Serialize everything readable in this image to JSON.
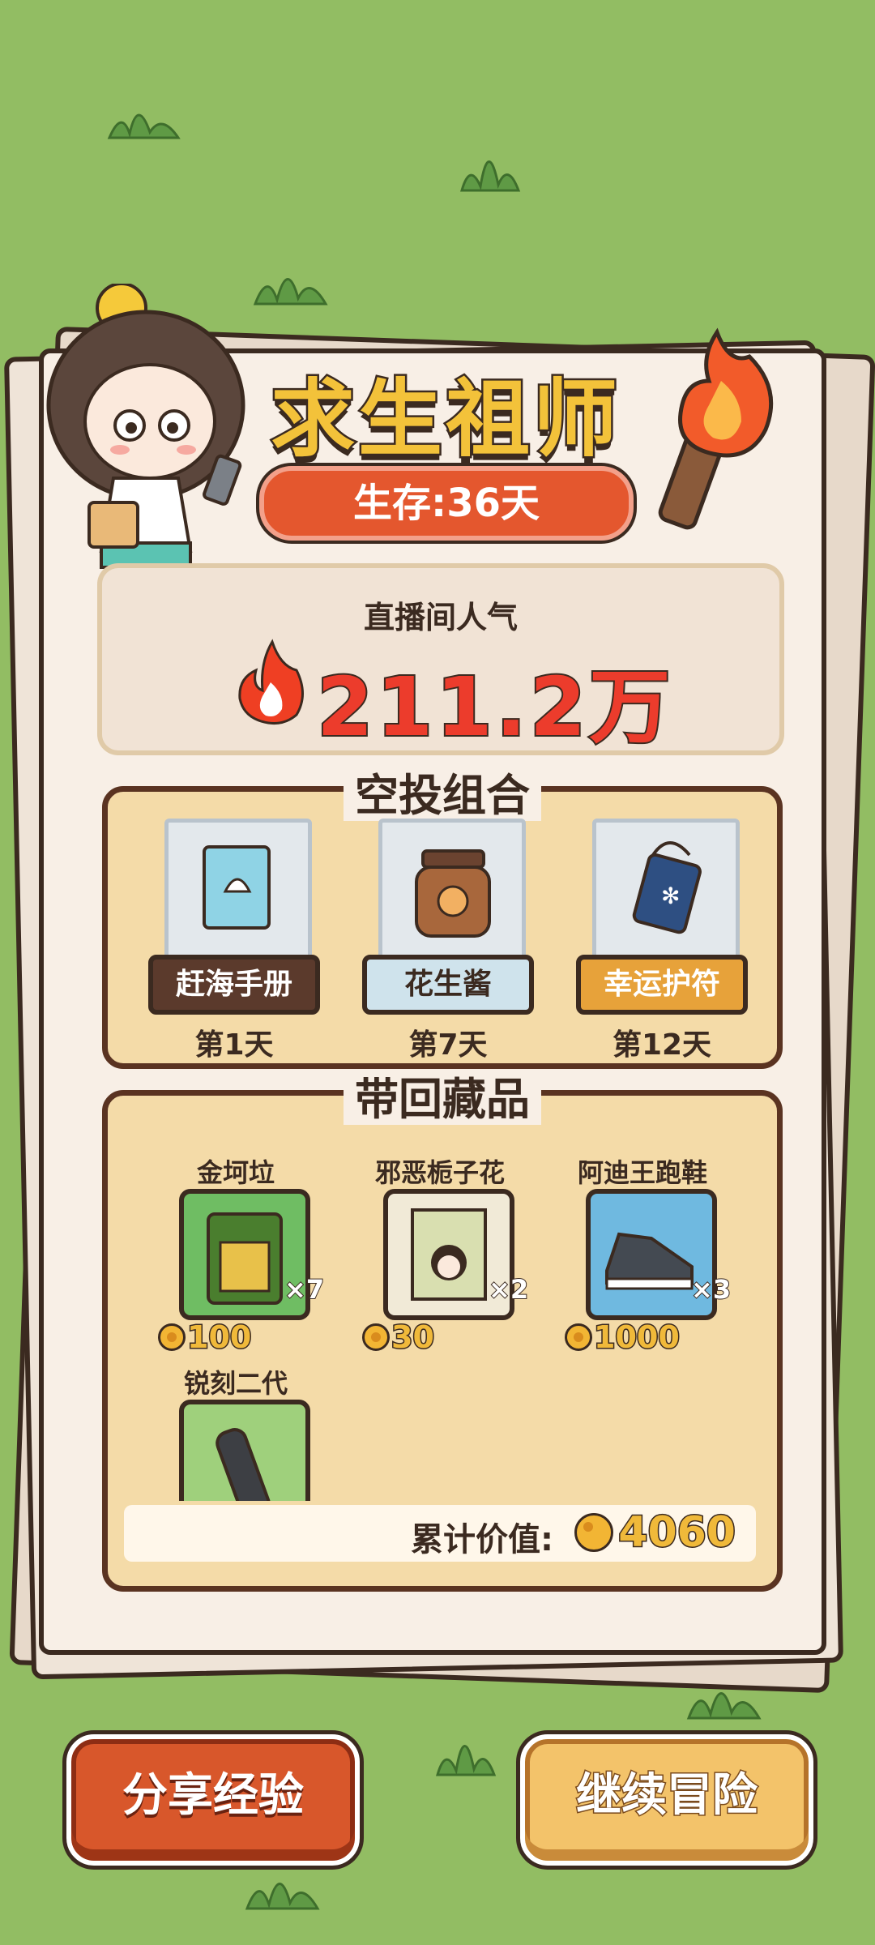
{
  "header": {
    "title": "求生祖师",
    "survival_days": "生存:36天"
  },
  "popularity": {
    "label": "直播间人气",
    "value": "211.2万"
  },
  "airdrop": {
    "title": "空投组合",
    "items": [
      {
        "name": "赶海手册",
        "day": "第1天",
        "style": "dark"
      },
      {
        "name": "花生酱",
        "day": "第7天",
        "style": "light"
      },
      {
        "name": "幸运护符",
        "day": "第12天",
        "style": "gold"
      }
    ]
  },
  "collection": {
    "title": "带回藏品",
    "items": [
      {
        "name": "金坷垃",
        "count": "×7",
        "price": "100",
        "frame_color": "#6fbd63"
      },
      {
        "name": "邪恶栀子花",
        "count": "×2",
        "price": "30",
        "frame_color": "#f1ead7"
      },
      {
        "name": "阿迪王跑鞋",
        "count": "×3",
        "price": "1000",
        "frame_color": "#6fb9e0"
      },
      {
        "name": "锐刻二代",
        "count": "",
        "price": "",
        "frame_color": "#9fd07c"
      }
    ],
    "total_label": "累计价值:",
    "total_value": "4060"
  },
  "buttons": {
    "share": "分享经验",
    "continue": "继续冒险"
  }
}
